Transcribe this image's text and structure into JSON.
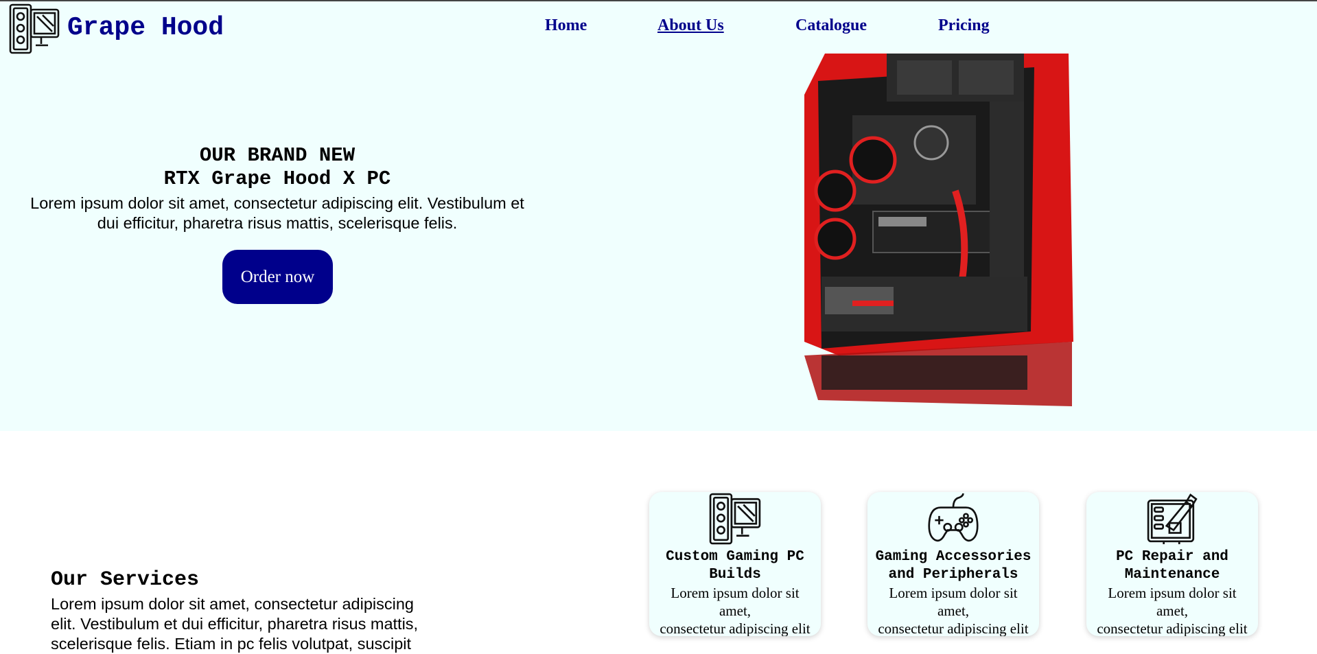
{
  "brand": {
    "name": "Grape Hood",
    "logo_icon": "pc-tower-icon"
  },
  "nav": {
    "items": [
      {
        "label": "Home"
      },
      {
        "label": "About Us",
        "active": true
      },
      {
        "label": "Catalogue"
      },
      {
        "label": "Pricing"
      }
    ]
  },
  "hero": {
    "heading_line1": "OUR BRAND NEW",
    "heading_line2": "RTX Grape Hood X PC",
    "text_line1": "Lorem ipsum dolor sit amet, consectetur adipiscing elit. Vestibulum et",
    "text_line2": "dui efficitur, pharetra risus mattis, scelerisque felis.",
    "cta_label": "Order now",
    "image_icon": "gaming-pc-image"
  },
  "services": {
    "title": "Our Services",
    "text_line1": "Lorem ipsum dolor sit amet, consectetur adipiscing",
    "text_line2": "elit. Vestibulum et dui efficitur, pharetra risus mattis,",
    "text_line3": "scelerisque felis. Etiam in pc felis volutpat, suscipit",
    "cards": [
      {
        "title_line1": "Custom Gaming PC",
        "title_line2": "Builds",
        "text_line1": "Lorem ipsum dolor sit",
        "text_line2": "amet,",
        "text_line3": "consectetur adipiscing elit",
        "icon": "pc-build-icon"
      },
      {
        "title_line1": "Gaming Accessories",
        "title_line2": "and Peripherals",
        "text_line1": "Lorem ipsum dolor sit",
        "text_line2": "amet,",
        "text_line3": "consectetur adipiscing elit",
        "icon": "gamepad-icon"
      },
      {
        "title_line1": "PC Repair and",
        "title_line2": "Maintenance",
        "text_line1": "Lorem ipsum dolor sit",
        "text_line2": "amet,",
        "text_line3": "consectetur adipiscing elit",
        "icon": "repair-icon"
      }
    ]
  },
  "colors": {
    "brand": "#00008b",
    "hero_bg": "#f0fffe",
    "card_bg": "#f0fffe",
    "pc_red": "#e01010"
  }
}
